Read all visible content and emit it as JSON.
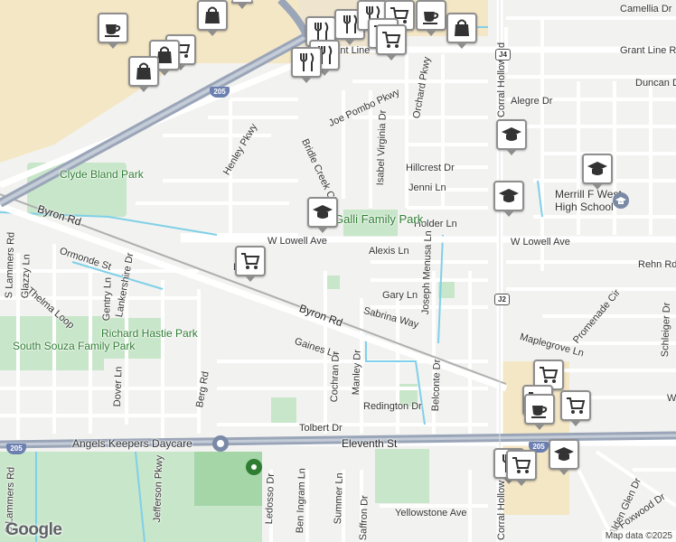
{
  "streets": {
    "grant_line": "Grant Line Rd",
    "grant_line_left": "Grant Line",
    "duncan": "Duncan Dr",
    "camellia": "Camellia Dr",
    "alegre": "Alegre Dr",
    "joe_pombo": "Joe Pombo Pkwy",
    "orchard": "Orchard Pkwy",
    "isabel": "Isabel Virginia Dr",
    "henley": "Henley Pkwy",
    "bridle": "Bridle Creek Cir",
    "hillcrest": "Hillcrest Dr",
    "jenni": "Jenni Ln",
    "holder": "Holder Ln",
    "w_lowell_left": "W Lowell Ave",
    "w_lowell_right": "W Lowell Ave",
    "alexis": "Alexis Ln",
    "joseph_menusa": "Joseph Menusa Ln",
    "rehn": "Rehn Rd",
    "gary": "Gary Ln",
    "sabrina": "Sabrina Way",
    "promenade": "Promenade Cir",
    "schleiger": "Schleiger Dr",
    "maplegrove": "Maplegrove Ln",
    "byron_left": "Byron Rd",
    "byron_mid": "Byron Rd",
    "ormonde": "Ormonde St",
    "thelma": "Thelma Loop",
    "glazzy": "Glazzy Ln",
    "s_lammers_top": "S Lammers Rd",
    "s_lammers_bottom": "S Lammers Rd",
    "gentry": "Gentry Ln",
    "lankershire": "Lankershire Dr",
    "dover": "Dover Ln",
    "berg": "Berg Rd",
    "gaines": "Gaines Ln",
    "cochran": "Cochran Dr",
    "manley": "Manley Dr",
    "belconte": "Belconte Dr",
    "redington": "Redington Dr",
    "tolbert": "Tolbert Dr",
    "eleventh": "Eleventh St",
    "jefferson": "Jefferson Pkwy",
    "ben_ingram": "Ben Ingram Ln",
    "summer": "Summer Ln",
    "saffron": "Saffron Dr",
    "yellowstone": "Yellowstone Ave",
    "alden_glen": "Alden Glen Dr",
    "foxwood": "Foxwood Dr",
    "corral_hollow": "Corral Hollow Rd",
    "corral_hollow_bottom": "Corral Hollow Rd",
    "ledosso": "Ledosso Dr",
    "lowell_stub": "Lo",
    "w_edge": "W"
  },
  "parks": {
    "clyde": "Clyde Bland Park",
    "galli": "Galli Family Park",
    "richard": "Richard Hastie Park",
    "south_souza": "South Souza Family Park"
  },
  "places": {
    "merrill": "Merrill F West High School",
    "angels": "Angels Keepers Daycare"
  },
  "shields": {
    "i205_top": "205",
    "i205_bottom": "205",
    "i205_right": "205",
    "j4": "J4",
    "j2": "J2"
  },
  "markers": [
    {
      "type": "cafe",
      "icon": "coffee-cup-icon"
    },
    {
      "type": "shopping",
      "icon": "shopping-bag-icon"
    },
    {
      "type": "grocery",
      "icon": "shopping-cart-icon"
    },
    {
      "type": "restaurant",
      "icon": "fork-knife-icon"
    },
    {
      "type": "school",
      "icon": "graduation-cap-icon"
    }
  ],
  "attribution": {
    "logo": "Google",
    "copyright": "Map data ©2025"
  },
  "colors": {
    "road_major": "#ffffff",
    "freeway": "#9aa5b8",
    "park": "#c8e6c9",
    "water": "#7fd0e8",
    "rail": "#b0b0b0",
    "commercial": "#f4e7c5"
  }
}
